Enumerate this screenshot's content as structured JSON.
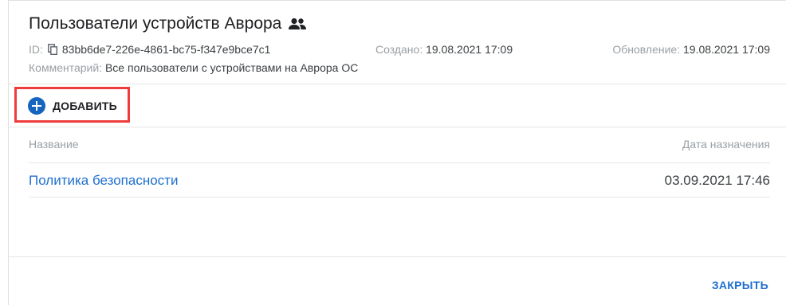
{
  "dialog": {
    "title": "Пользователи устройств Аврора",
    "title_icon": "group-icon",
    "id_label": "ID:",
    "id_value": "83bb6de7-226e-4861-bc75-f347e9bce7c1",
    "copy_icon": "copy-icon",
    "created_label": "Создано:",
    "created_value": "19.08.2021 17:09",
    "updated_label": "Обновление:",
    "updated_value": "19.08.2021 17:09",
    "comment_label": "Комментарий:",
    "comment_value": "Все пользователи с устройствами на Аврора ОС"
  },
  "toolbar": {
    "add_label": "ДОБАВИТЬ",
    "add_icon": "plus-circle-icon",
    "accent_color": "#1565c0",
    "highlight_color": "#ef3b3b"
  },
  "table": {
    "columns": [
      "Название",
      "Дата назначения"
    ],
    "rows": [
      {
        "name": "Политика безопасности",
        "date": "03.09.2021 17:46"
      }
    ]
  },
  "footer": {
    "close_label": "ЗАКРЫТЬ",
    "link_color": "#1e6fd0"
  }
}
